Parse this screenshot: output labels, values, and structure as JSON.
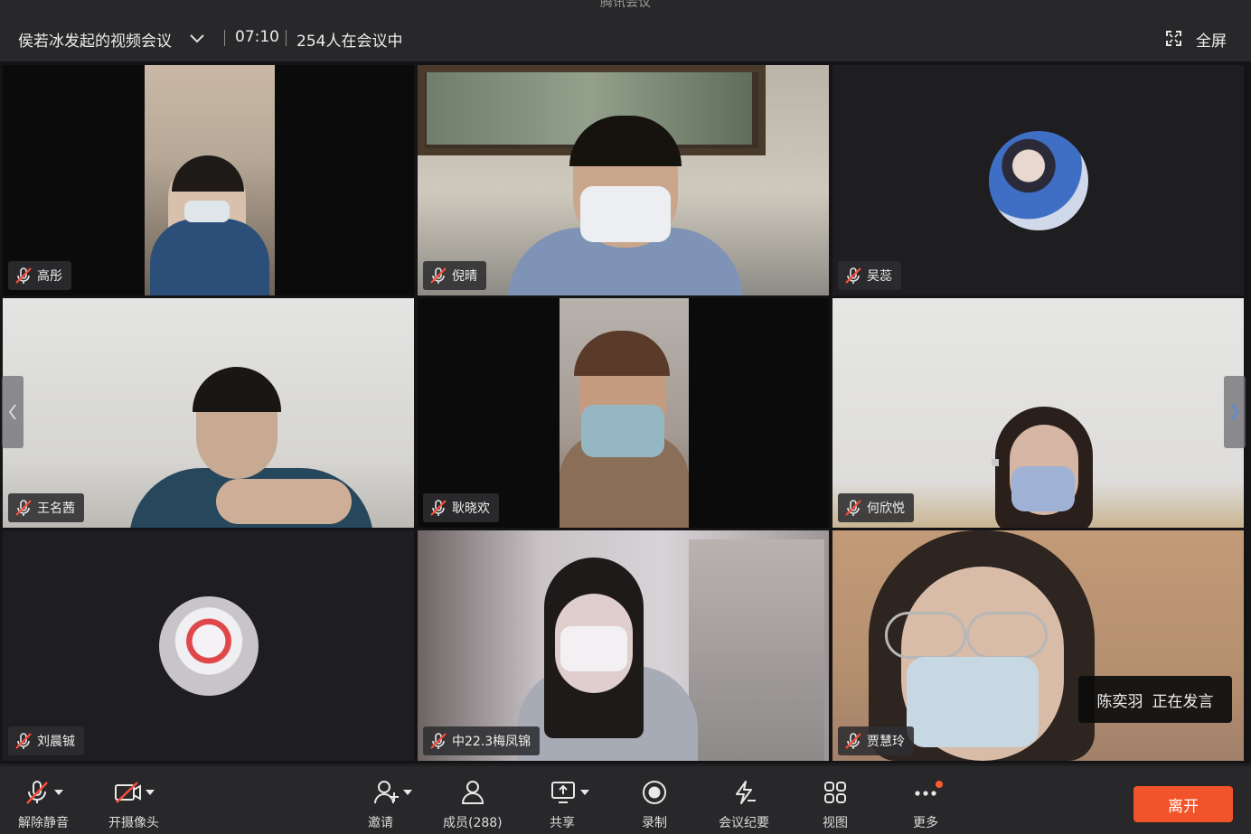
{
  "window": {
    "app_name": "腾讯会议"
  },
  "header": {
    "meeting_title": "侯若冰发起的视频会议",
    "duration": "07:10",
    "participants_in_meeting": "254人在会议中",
    "fullscreen_label": "全屏"
  },
  "tiles": [
    {
      "name": "高彤"
    },
    {
      "name": "倪晴"
    },
    {
      "name": "吴蕊"
    },
    {
      "name": "王名茜"
    },
    {
      "name": "耿晓欢"
    },
    {
      "name": "何欣悦"
    },
    {
      "name": "刘晨铖"
    },
    {
      "name": "中22.3梅凤锦"
    },
    {
      "name": "贾慧玲"
    }
  ],
  "speaking": {
    "speaker": "陈奕羽",
    "status": "正在发言"
  },
  "toolbar": {
    "unmute": "解除静音",
    "camera": "开摄像头",
    "invite": "邀请",
    "members": "成员(288)",
    "share": "共享",
    "record": "录制",
    "minutes": "会议纪要",
    "view": "视图",
    "more": "更多",
    "leave": "离开"
  },
  "colors": {
    "accent": "#f1532a",
    "notification_dot": "#ff5a2c",
    "bar": "#28282a"
  }
}
